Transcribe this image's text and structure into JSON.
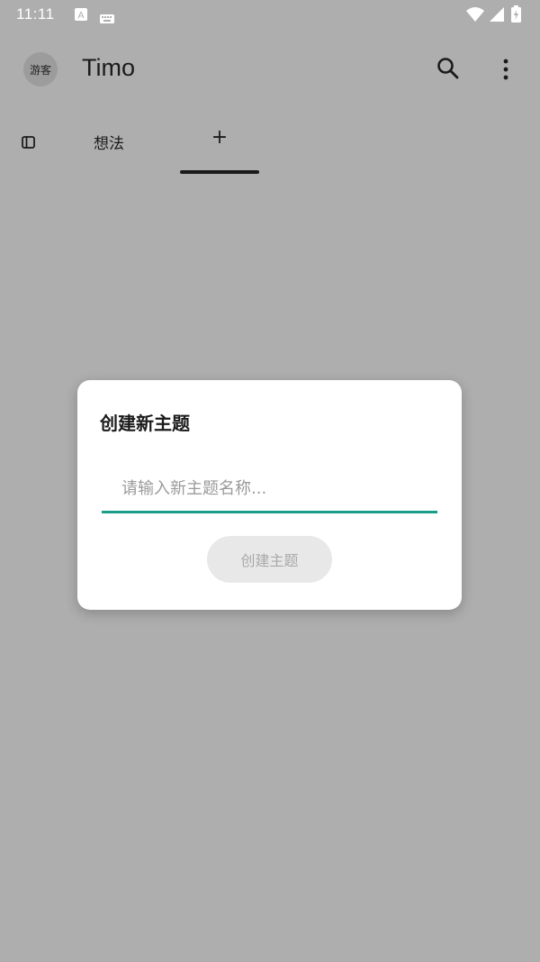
{
  "status_bar": {
    "time": "11:11",
    "icons": [
      "notification-a-icon",
      "keyboard-icon",
      "wifi-icon",
      "signal-icon",
      "battery-icon"
    ]
  },
  "app_bar": {
    "avatar_label": "游客",
    "title": "Timo",
    "actions": [
      "search-icon",
      "more-vert-icon"
    ]
  },
  "tabs": {
    "items": [
      {
        "label": "想法"
      },
      {
        "label": "+"
      }
    ],
    "selected_index": 1,
    "panel_icon": "sidebar-panel-icon"
  },
  "dialog": {
    "title": "创建新主题",
    "input": {
      "value": "",
      "placeholder": "请输入新主题名称..."
    },
    "button_label": "创建主题",
    "button_enabled": false
  },
  "colors": {
    "scrim_background": "#aeaeae",
    "input_underline": "#1a9e8a",
    "button_disabled_bg": "#e8e8e8",
    "button_disabled_text": "#a9a9a9"
  }
}
